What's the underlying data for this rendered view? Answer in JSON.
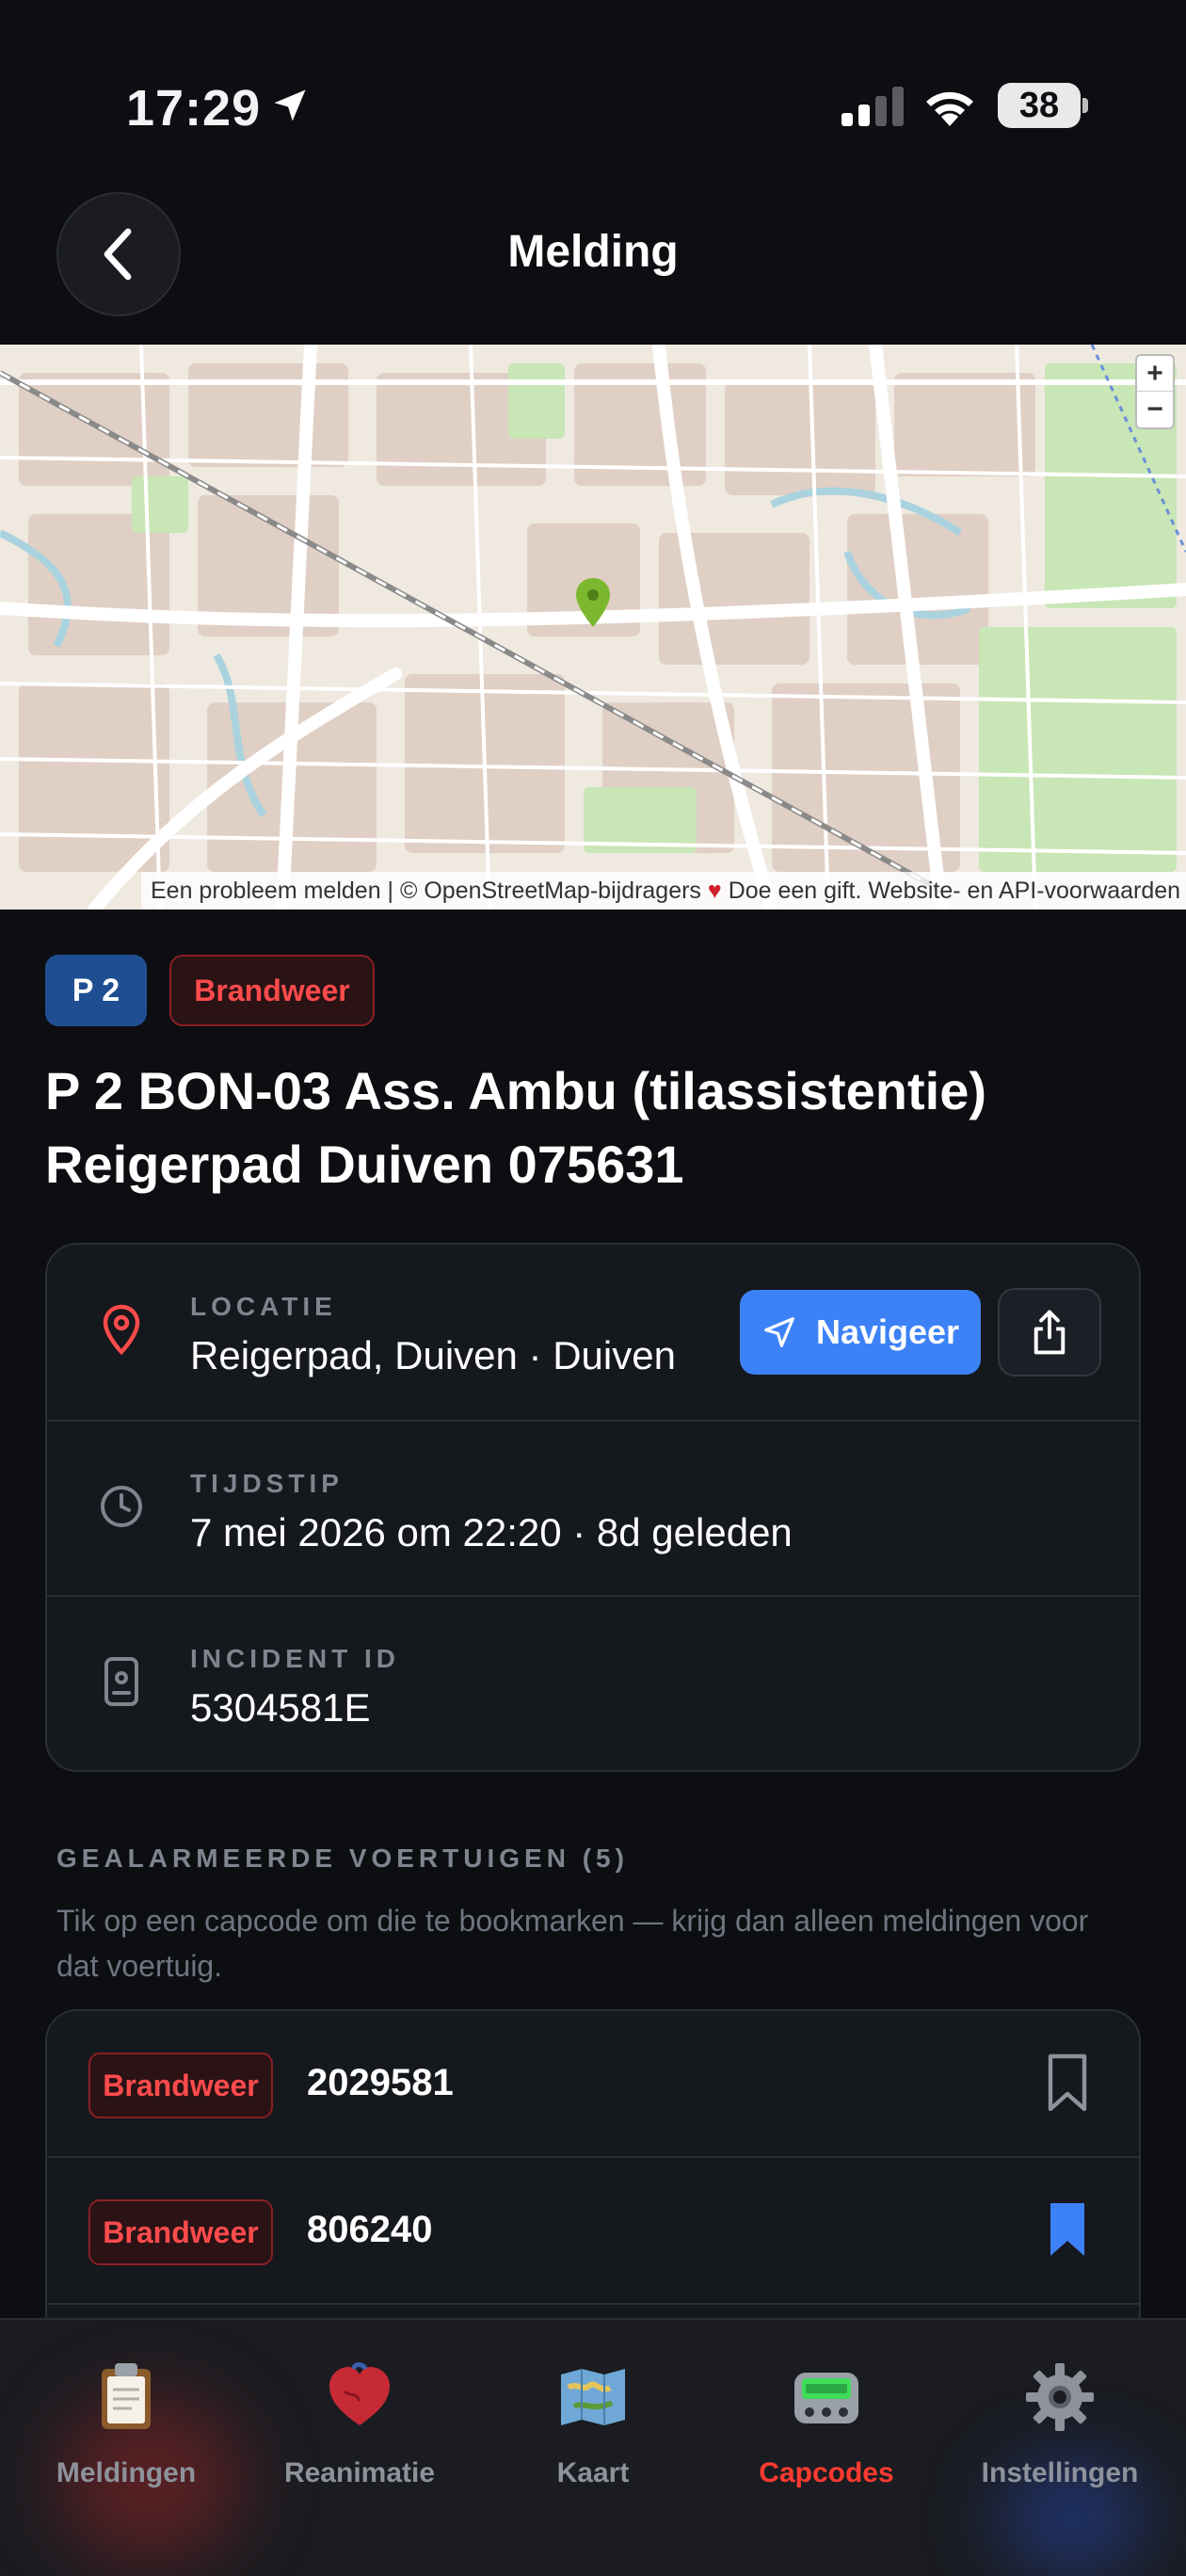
{
  "status_bar": {
    "time": "17:29",
    "battery": "38"
  },
  "header": {
    "title": "Melding"
  },
  "map": {
    "zoom_in": "+",
    "zoom_out": "−",
    "attribution_1": "Een probleem melden | © OpenStreetMap-bijdragers",
    "attribution_2": "Doe een gift. Website- en API-voorwaarden"
  },
  "incident": {
    "priority": "P 2",
    "service": "Brandweer",
    "title": "P 2 BON-03 Ass. Ambu (tilassistentie) Reigerpad Duiven 075631",
    "location_label": "LOCATIE",
    "location_value": "Reigerpad, Duiven · Duiven",
    "navigate_label": "Navigeer",
    "time_label": "TIJDSTIP",
    "time_value": "7 mei 2026 om 22:20 · 8d geleden",
    "id_label": "INCIDENT ID",
    "id_value": "5304581E"
  },
  "vehicles": {
    "title": "GEALARMEERDE VOERTUIGEN (5)",
    "hint": "Tik op een capcode om die te bookmarken — krijg dan alleen meldingen voor dat voertuig.",
    "items": [
      {
        "service": "Brandweer",
        "capcode": "2029581",
        "bookmarked": false
      },
      {
        "service": "Brandweer",
        "capcode": "806240",
        "bookmarked": true
      }
    ]
  },
  "tabs": [
    {
      "label": "Meldingen",
      "icon": "clipboard-icon",
      "active": false
    },
    {
      "label": "Reanimatie",
      "icon": "heart-icon",
      "active": false
    },
    {
      "label": "Kaart",
      "icon": "map-icon",
      "active": false
    },
    {
      "label": "Capcodes",
      "icon": "pager-icon",
      "active": true
    },
    {
      "label": "Instellingen",
      "icon": "gear-icon",
      "active": false
    }
  ],
  "colors": {
    "accent_blue": "#3c82f6",
    "brandweer_red": "#ff4b4b",
    "active_tab": "#ff3b30",
    "priority_blue": "#1f4f92",
    "map_marker": "#7cb82f"
  }
}
